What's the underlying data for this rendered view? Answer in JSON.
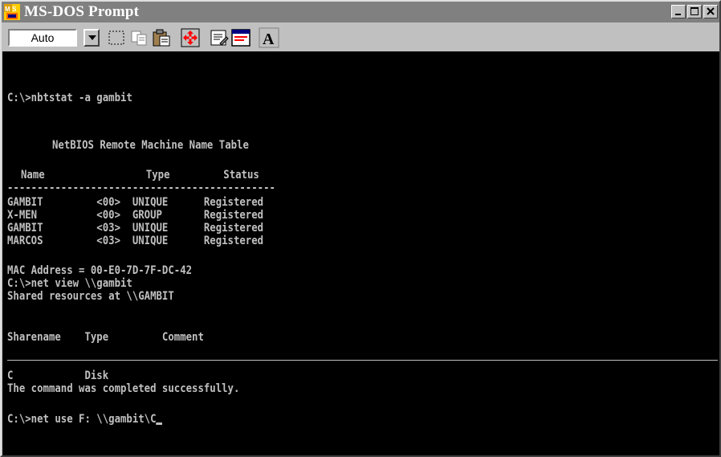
{
  "window": {
    "title": "MS-DOS Prompt",
    "buttons": [
      "minimize-icon",
      "maximize-icon",
      "close-icon"
    ]
  },
  "toolbar": {
    "font_size_value": "Auto",
    "tools": [
      "mark-icon",
      "copy-icon",
      "paste-icon",
      "fullscreen-icon",
      "properties-icon",
      "background-icon",
      "font-icon"
    ],
    "font_tool_label": "A"
  },
  "terminal": {
    "lines": [
      "C:\\>nbtstat -a gambit",
      "NetBIOS Remote Machine Name Table",
      "Name                 Type         Status",
      "---------------------------------------------",
      "GAMBIT         <00>  UNIQUE      Registered",
      "X-MEN          <00>  GROUP       Registered",
      "GAMBIT         <03>  UNIQUE      Registered",
      "MARCOS         <03>  UNIQUE      Registered",
      "MAC Address = 00-E0-7D-7F-DC-42",
      "C:\\>net view \\\\gambit",
      "Shared resources at \\\\GAMBIT",
      "Sharename    Type         Comment",
      "C            Disk",
      "The command was completed successfully.",
      "C:\\>net use F: \\\\gambit\\C"
    ]
  },
  "colors": {
    "titlebar": "#808080",
    "terminal_bg": "#000000",
    "terminal_text": "#c0c0c0",
    "chrome": "#c0c0c0"
  }
}
